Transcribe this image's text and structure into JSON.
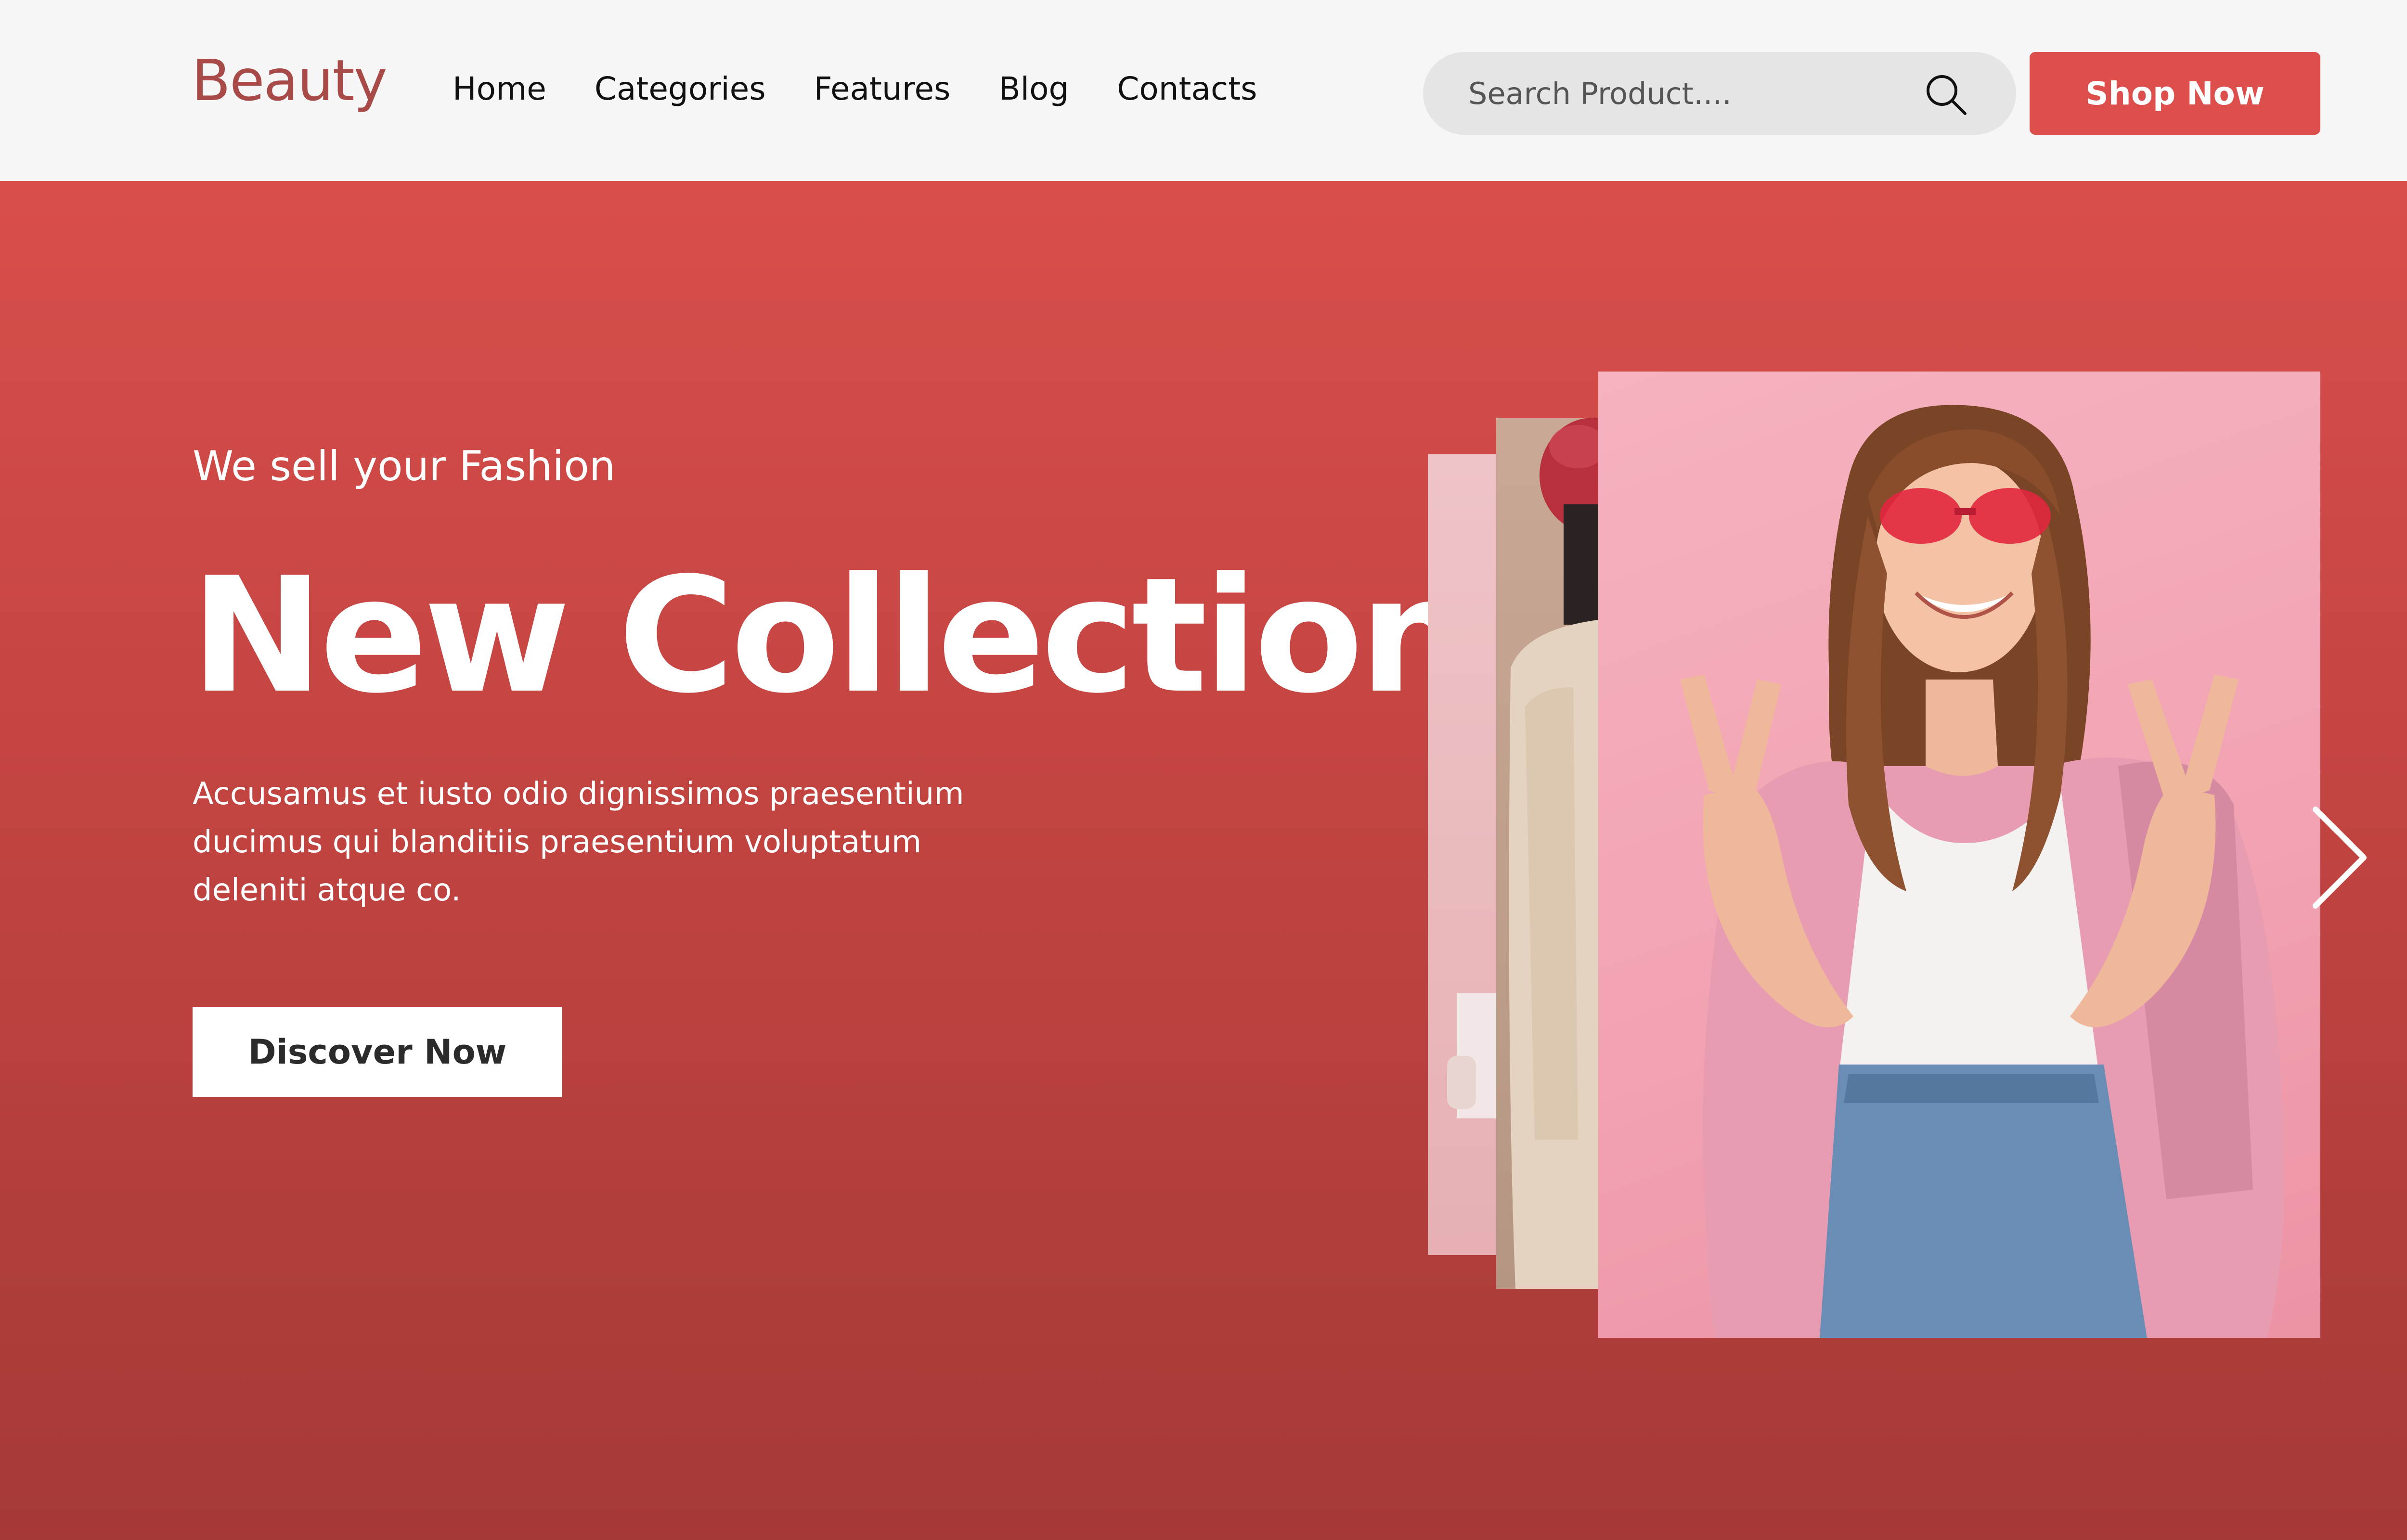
{
  "header": {
    "logo": "Beauty",
    "nav": [
      "Home",
      "Categories",
      "Features",
      "Blog",
      "Contacts"
    ],
    "search": {
      "placeholder": "Search Product....",
      "icon": "search-icon"
    },
    "cta_label": "Shop Now"
  },
  "hero": {
    "tagline": "We sell your Fashion",
    "headline": "New Collection",
    "description": "Accusamus et iusto odio dignissimos praesentium ducimus qui blanditiis praesentium voluptatum deleniti atque co.",
    "button_label": "Discover Now",
    "carousel": {
      "next_icon": "chevron-right-icon",
      "slides": [
        "fashion-photo-woman-peace-sign",
        "fashion-photo-red-beret",
        "fashion-photo-pink"
      ]
    }
  },
  "colors": {
    "brand": "#dc4f4d",
    "logo": "#a84a48",
    "header_bg": "#f6f6f6",
    "search_bg": "#e5e5e5",
    "hero_top": "#d94e4b",
    "hero_bottom": "#a53938"
  }
}
